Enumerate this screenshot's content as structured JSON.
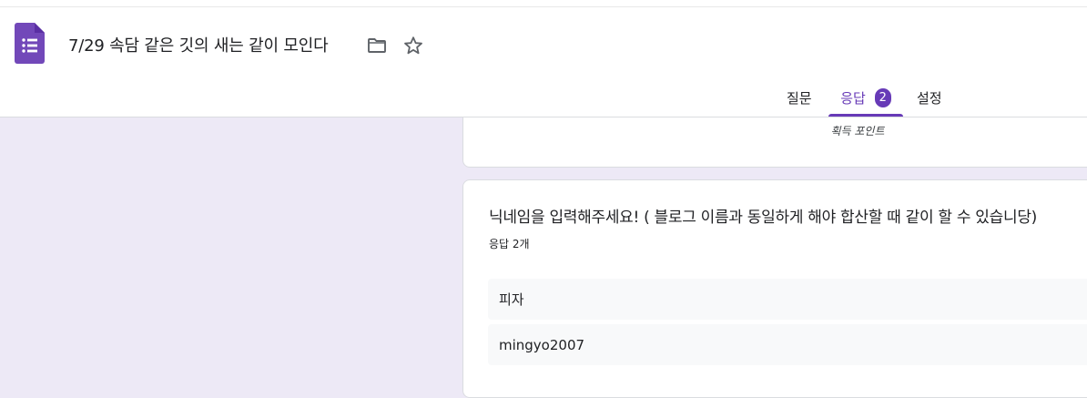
{
  "colors": {
    "accent": "#673ab7",
    "page_background": "#ede9f6",
    "answer_background": "#f8f9fa"
  },
  "header": {
    "logo_icon": "google-forms-icon",
    "title": "7/29 속담 같은 깃의 새는 같이 모인다",
    "folder_icon": "folder-icon",
    "star_icon": "star-outline-icon"
  },
  "tabs": {
    "questions": "질문",
    "responses": "응답",
    "responses_badge": "2",
    "settings": "설정",
    "active": "responses"
  },
  "summary_card": {
    "points_label": "획득 포인트"
  },
  "question_card": {
    "title": "닉네임을 입력해주세요! ( 블로그 이름과 동일하게 해야 합산할 때 같이 할 수 있습니당)",
    "response_count": "응답 2개",
    "answers": [
      "피자",
      "mingyo2007"
    ]
  }
}
